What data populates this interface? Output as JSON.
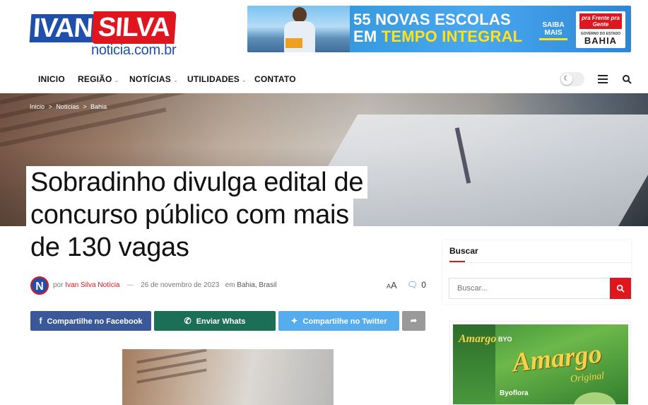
{
  "header": {
    "logo_left": "IVAN",
    "logo_right": "SILVA",
    "logo_sub": "noticia.com.br",
    "banner": {
      "line1": "55 NOVAS ESCOLAS",
      "line2_a": "EM ",
      "line2_b": "TEMPO INTEGRAL",
      "saiba": "SAIBA MAIS",
      "pra_frente": "pra Frente pra Gente",
      "gov": "GOVERNO DO ESTADO",
      "bahia": "BAHIA"
    }
  },
  "nav": {
    "items": [
      {
        "label": "INICIO",
        "has_menu": false
      },
      {
        "label": "REGIÃO",
        "has_menu": true
      },
      {
        "label": "NOTÍCIAS",
        "has_menu": true
      },
      {
        "label": "UTILIDADES",
        "has_menu": true
      },
      {
        "label": "CONTATO",
        "has_menu": false
      }
    ],
    "chevron": "⌄"
  },
  "breadcrumb": {
    "items": [
      "Inicio",
      "Notícias",
      "Bahia"
    ],
    "sep": ">"
  },
  "article": {
    "title_lines": [
      "Sobradinho divulga edital de",
      "concurso público com mais",
      "de 130 vagas"
    ],
    "avatar_letter": "N",
    "by": "por",
    "author": "Ivan Silva Notícia",
    "dash": "—",
    "date": "26 de novembro de 2023",
    "in": "em",
    "categories": "Bahia, Brasil",
    "font_small": "A",
    "font_big": "A",
    "comment_count": "0"
  },
  "share": {
    "facebook": "Compartilhe no Facebook",
    "whatsapp": "Enviar Whats",
    "twitter": "Compartilhe no Twitter"
  },
  "sidebar": {
    "search_title": "Buscar",
    "search_placeholder": "Buscar..."
  },
  "ad": {
    "brand_small": "Amargo",
    "byo": "BYO",
    "brand": "Amargo",
    "original": "Original",
    "byoflora": "Byoflora"
  },
  "colors": {
    "accent_red": "#e0161e",
    "brand_blue": "#1f4fa8",
    "facebook": "#3b5998",
    "whatsapp": "#1a6f55",
    "twitter": "#55acee"
  }
}
